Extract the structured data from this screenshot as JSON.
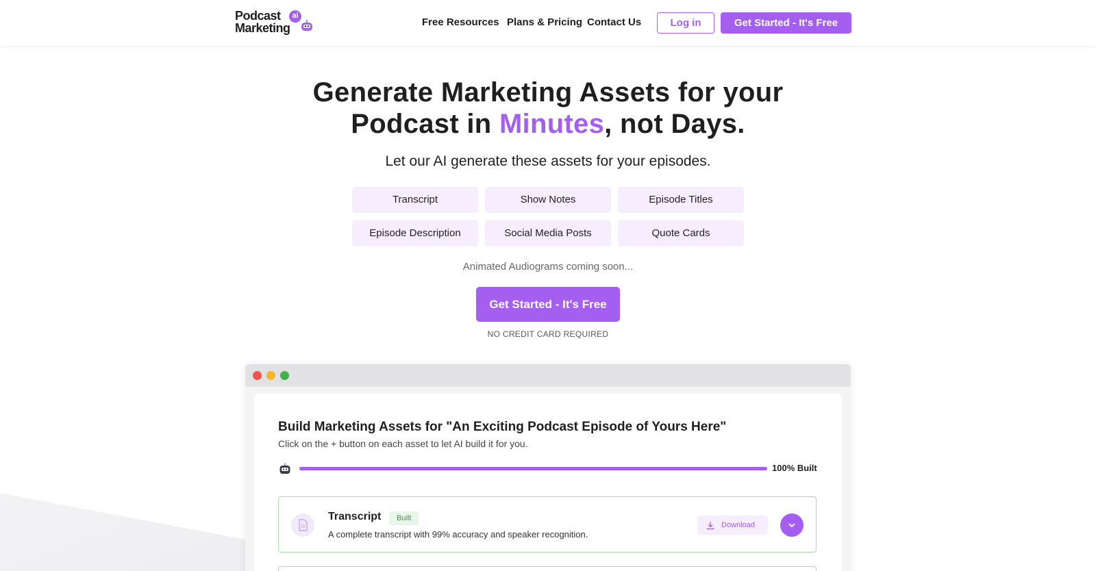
{
  "logo": {
    "line1": "Podcast",
    "badge": "ai",
    "line2": "Marketing"
  },
  "nav": {
    "free_resources": "Free Resources",
    "plans_pricing": "Plans & Pricing",
    "contact_us": "Contact Us",
    "login": "Log in",
    "get_started": "Get Started - It's Free"
  },
  "hero": {
    "title_line1": "Generate Marketing Assets for your",
    "title_line2_pre": "Podcast in ",
    "title_line2_accent": "Minutes",
    "title_line2_post": ", not Days.",
    "subtitle": "Let our AI generate these assets for your episodes.",
    "chips": [
      "Transcript",
      "Show Notes",
      "Episode Titles",
      "Episode Description",
      "Social Media Posts",
      "Quote Cards"
    ],
    "coming_soon": "Animated Audiograms coming soon...",
    "cta": "Get Started - It's Free",
    "no_credit_card": "NO CREDIT CARD REQUIRED"
  },
  "preview": {
    "title": "Build Marketing Assets for \"An Exciting Podcast Episode of Yours Here\"",
    "hint": "Click on the + button on each asset to let AI build it for you.",
    "progress": 1.0,
    "progress_label": "100% Built",
    "card": {
      "name": "Transcript",
      "badge": "Built",
      "description": "A complete transcript with 99% accuracy and speaker recognition.",
      "download": "Download"
    }
  },
  "colors": {
    "accent": "#a55ff0",
    "chip_bg": "#f6eefe",
    "success_border": "#a7dca8"
  }
}
